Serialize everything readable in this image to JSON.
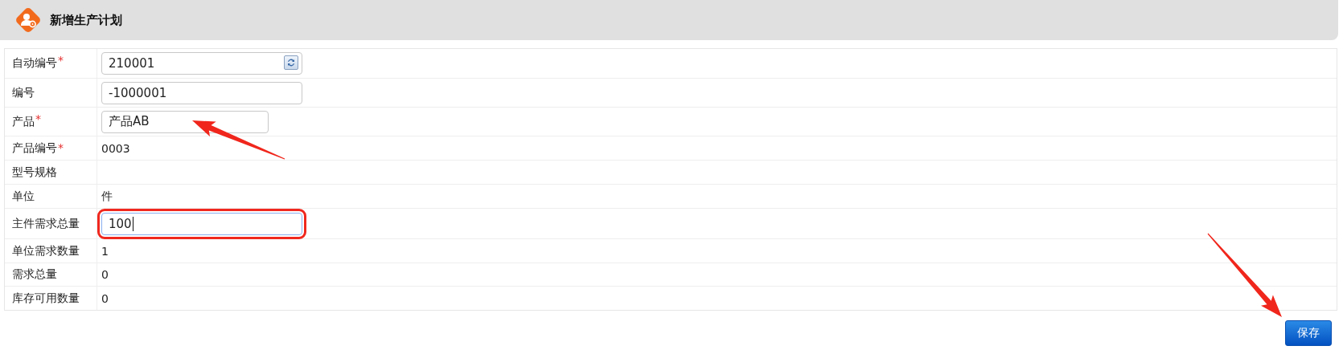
{
  "header": {
    "title": "新增生产计划"
  },
  "form": {
    "rows": [
      {
        "label": "自动编号",
        "required_mark": "*",
        "kind": "input",
        "value": "210001",
        "refresh_button": true
      },
      {
        "label": "编号",
        "kind": "input",
        "value": "-1000001"
      },
      {
        "label": "产品",
        "required_mark": "*",
        "kind": "short_input",
        "value": "产品AB",
        "annotation_arrow": true
      },
      {
        "label": "产品编号",
        "required_mark": "*",
        "kind": "text",
        "value": "0003"
      },
      {
        "label": "型号规格",
        "kind": "text"
      },
      {
        "label": "单位",
        "kind": "text",
        "value": "件"
      },
      {
        "label": "主件需求总量",
        "kind": "input",
        "value": "100",
        "focused": true,
        "highlighted": true
      },
      {
        "label": "单位需求数量",
        "kind": "text",
        "value": "1"
      },
      {
        "label": "需求总量",
        "kind": "text",
        "value": "0"
      },
      {
        "label": "库存可用数量",
        "kind": "text",
        "value": "0"
      }
    ]
  },
  "save_button": {
    "label": "保存",
    "annotation_arrow": true
  }
}
